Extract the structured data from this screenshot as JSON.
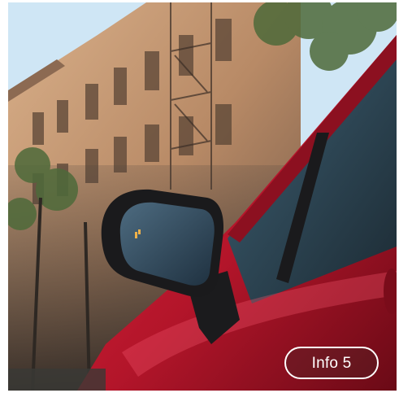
{
  "photo": {
    "subject": "car-side-mirror",
    "colors": {
      "sky": "#cfe6f5",
      "building": "#b98d6c",
      "car_red": "#c21a2c",
      "car_dark": "#5c0a12",
      "mirror_glass": "#2f4a5e",
      "shadow": "#3a3430"
    }
  },
  "overlay": {
    "info_label": "Info 5"
  }
}
